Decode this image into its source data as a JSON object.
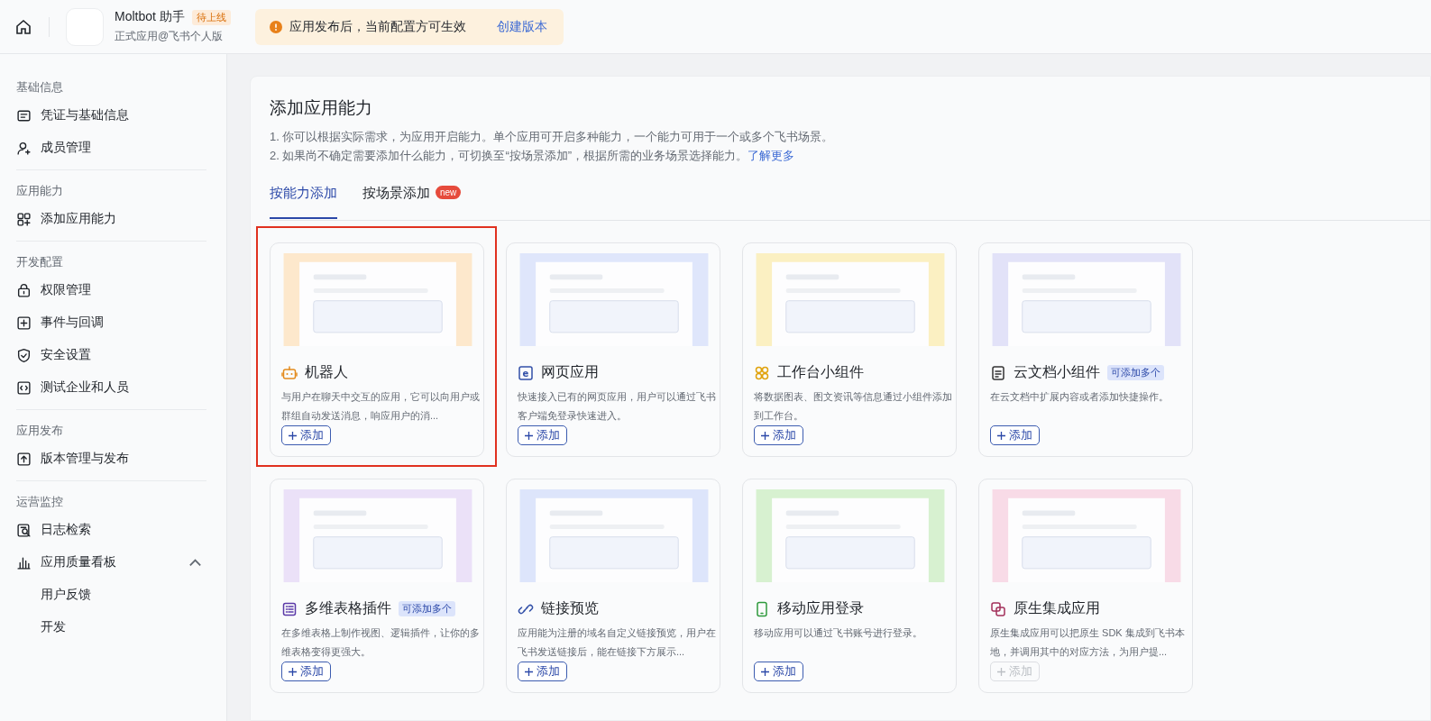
{
  "topbar": {
    "app_name": "Moltbot 助手",
    "status_badge": "待上线",
    "app_type": "正式应用@飞书个人版",
    "notice": {
      "text": "应用发布后，当前配置方可生效",
      "link": "创建版本"
    }
  },
  "sidebar": {
    "sections": [
      {
        "title": "基础信息",
        "items": [
          {
            "label": "凭证与基础信息",
            "kind": "credential"
          },
          {
            "label": "成员管理",
            "kind": "member"
          }
        ]
      },
      {
        "title": "应用能力",
        "items": [
          {
            "label": "添加应用能力",
            "kind": "add-grid"
          }
        ]
      },
      {
        "title": "开发配置",
        "items": [
          {
            "label": "权限管理",
            "kind": "lock"
          },
          {
            "label": "事件与回调",
            "kind": "event"
          },
          {
            "label": "安全设置",
            "kind": "shield"
          },
          {
            "label": "测试企业和人员",
            "kind": "code"
          }
        ]
      },
      {
        "title": "应用发布",
        "items": [
          {
            "label": "版本管理与发布",
            "kind": "upload"
          }
        ]
      },
      {
        "title": "运营监控",
        "items": [
          {
            "label": "日志检索",
            "kind": "log"
          },
          {
            "label": "应用质量看板",
            "kind": "chart",
            "expanded": true,
            "children": [
              {
                "label": "用户反馈"
              },
              {
                "label": "开发"
              }
            ]
          }
        ]
      }
    ]
  },
  "main": {
    "title": "添加应用能力",
    "notes": [
      "1. 你可以根据实际需求，为应用开启能力。单个应用可开启多种能力，一个能力可用于一个或多个飞书场景。",
      "2. 如果尚不确定需要添加什么能力，可切换至“按场景添加”，根据所需的业务场景选择能力。"
    ],
    "learn_more": "了解更多",
    "tabs": [
      {
        "label": "按能力添加",
        "selected": true
      },
      {
        "label": "按场景添加",
        "selected": false,
        "badge": "new"
      }
    ],
    "cards": [
      {
        "title": "机器人",
        "kind": "bot",
        "color": "#fde8cc",
        "description": "与用户在聊天中交互的应用，它可以向用户或群组自动发送消息，响应用户的消...",
        "button": "添加",
        "disabled": false,
        "highlighted": true
      },
      {
        "title": "网页应用",
        "kind": "web",
        "icon_letter": "e",
        "color": "#dfe6fb",
        "description": "快速接入已有的网页应用，用户可以通过飞书客户端免登录快速进入。",
        "button": "添加",
        "disabled": false,
        "highlighted": false
      },
      {
        "title": "工作台小组件",
        "kind": "widget",
        "color": "#fbf0c2",
        "description": "将数据图表、图文资讯等信息通过小组件添加到工作台。",
        "button": "添加",
        "disabled": false,
        "highlighted": false
      },
      {
        "title": "云文档小组件",
        "kind": "doc",
        "color": "#e2e2f8",
        "tag": "可添加多个",
        "description": "在云文档中扩展内容或者添加快捷操作。",
        "button": "添加",
        "disabled": false,
        "highlighted": false
      },
      {
        "title": "多维表格插件",
        "kind": "table",
        "color": "#ebe1f8",
        "tag": "可添加多个",
        "description": "在多维表格上制作视图、逻辑插件，让你的多维表格变得更强大。",
        "button": "添加",
        "disabled": false,
        "highlighted": false
      },
      {
        "title": "链接预览",
        "kind": "link",
        "color": "#dde5fb",
        "description": "应用能为注册的域名自定义链接预览，用户在飞书发送链接后，能在链接下方展示...",
        "button": "添加",
        "disabled": false,
        "highlighted": false
      },
      {
        "title": "移动应用登录",
        "kind": "phone",
        "color": "#d7f1d0",
        "description": "移动应用可以通过飞书账号进行登录。",
        "button": "添加",
        "disabled": false,
        "highlighted": false
      },
      {
        "title": "原生集成应用",
        "kind": "native",
        "color": "#f8dbe7",
        "description": "原生集成应用可以把原生 SDK 集成到飞书本地，并调用其中的对应方法，为用户提...",
        "button": "添加",
        "disabled": true,
        "highlighted": false
      }
    ]
  }
}
